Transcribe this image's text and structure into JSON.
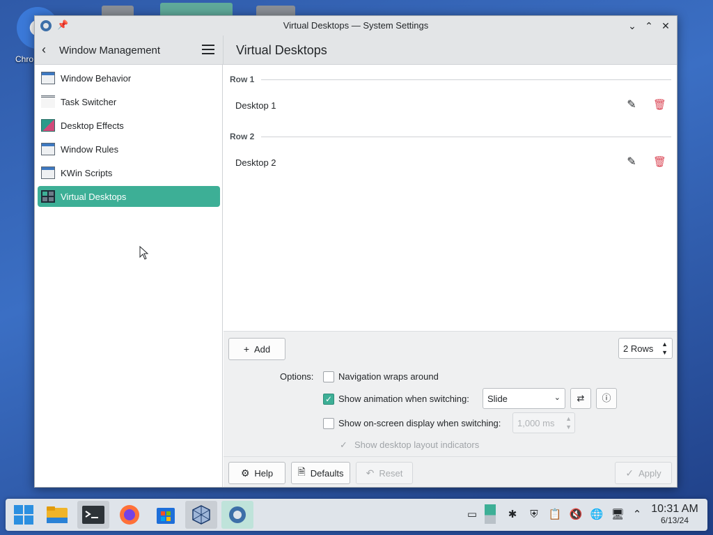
{
  "window": {
    "title": "Virtual Desktops — System Settings"
  },
  "desktop": {
    "chrome_label": "Chro"
  },
  "sidebar": {
    "header_title": "Window Management",
    "items": [
      {
        "label": "Window Behavior",
        "icon": "window-icon"
      },
      {
        "label": "Task Switcher",
        "icon": "task-switcher-icon"
      },
      {
        "label": "Desktop Effects",
        "icon": "desktop-effects-icon"
      },
      {
        "label": "Window Rules",
        "icon": "window-rules-icon"
      },
      {
        "label": "KWin Scripts",
        "icon": "kwin-scripts-icon"
      },
      {
        "label": "Virtual Desktops",
        "icon": "virtual-desktops-icon",
        "selected": true
      }
    ]
  },
  "main": {
    "title": "Virtual Desktops",
    "rows": [
      {
        "heading": "Row 1",
        "desktops": [
          "Desktop 1"
        ]
      },
      {
        "heading": "Row 2",
        "desktops": [
          "Desktop 2"
        ]
      }
    ],
    "add_label": "Add",
    "rows_spin_value": "2 Rows"
  },
  "options": {
    "label": "Options:",
    "navigation_wraps": {
      "text": "Navigation wraps around",
      "checked": false
    },
    "show_animation": {
      "text": "Show animation when switching:",
      "checked": true
    },
    "animation_select": "Slide",
    "show_osd": {
      "text": "Show on-screen display when switching:",
      "checked": false
    },
    "osd_duration": "1,000 ms",
    "show_layout_indicators": {
      "text": "Show desktop layout indicators",
      "checked": true,
      "enabled": false
    }
  },
  "buttons": {
    "help": "Help",
    "defaults": "Defaults",
    "reset": "Reset",
    "apply": "Apply"
  },
  "taskbar": {
    "time": "10:31 AM",
    "date": "6/13/24"
  },
  "colors": {
    "accent": "#3daf96",
    "danger": "#da4453"
  }
}
